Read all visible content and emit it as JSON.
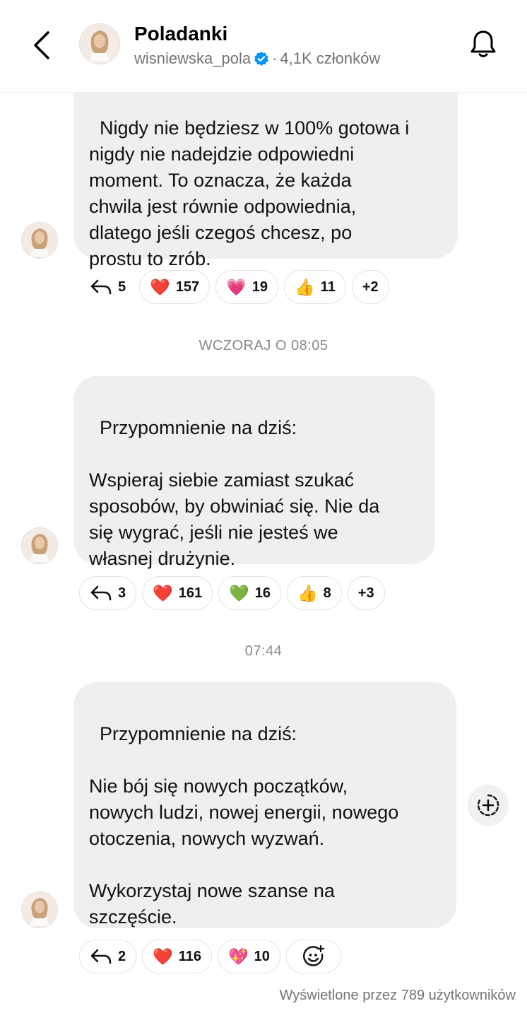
{
  "header": {
    "title": "Poladanki",
    "username": "wisniewska_pola",
    "separator": "·",
    "members": "4,1K członków"
  },
  "messages": [
    {
      "text": "Nigdy nie będziesz w 100% gotowa i\nnigdy nie nadejdzie odpowiedni\nmoment. To oznacza, że każda\nchwila jest równie odpowiednia,\ndlatego jeśli czegoś chcesz, po\nprostu to zrób.",
      "replies": "5",
      "reactions": [
        {
          "emoji": "❤️",
          "count": "157"
        },
        {
          "emoji": "💗",
          "count": "19"
        },
        {
          "emoji": "👍",
          "count": "11"
        }
      ],
      "more": "+2"
    },
    {
      "text": "Przypomnienie na dziś:\n\nWspieraj siebie zamiast szukać\nsposobów, by obwiniać się. Nie da\nsię wygrać, jeśli nie jesteś we\nwłasnej drużynie.",
      "replies": "3",
      "reactions": [
        {
          "emoji": "❤️",
          "count": "161"
        },
        {
          "emoji": "💚",
          "count": "16"
        },
        {
          "emoji": "👍",
          "count": "8"
        }
      ],
      "more": "+3"
    },
    {
      "text": "Przypomnienie na dziś:\n\nNie bój się nowych początków,\nnowych ludzi, nowej energii, nowego\notoczenia, nowych wyzwań.\n\nWykorzystaj nowe szanse na\nszczęście.",
      "replies": "2",
      "reactions": [
        {
          "emoji": "❤️",
          "count": "116"
        },
        {
          "emoji": "💖",
          "count": "10"
        }
      ]
    }
  ],
  "timestamps": {
    "first": "WCZORAJ O 08:05",
    "second": "07:44"
  },
  "footer": {
    "viewed": "Wyświetlone przez 789 użytkowników"
  },
  "icons": {
    "back": "chevron-left-icon",
    "bell": "bell-icon",
    "verified": "verified-badge-icon",
    "reply": "reply-arrow-icon",
    "add_reaction": "add-reaction-icon",
    "add_emoji": "emoji-add-icon"
  },
  "colors": {
    "bubble": "#efeff2",
    "verified": "#0095f6",
    "secondary_text": "#737373"
  }
}
